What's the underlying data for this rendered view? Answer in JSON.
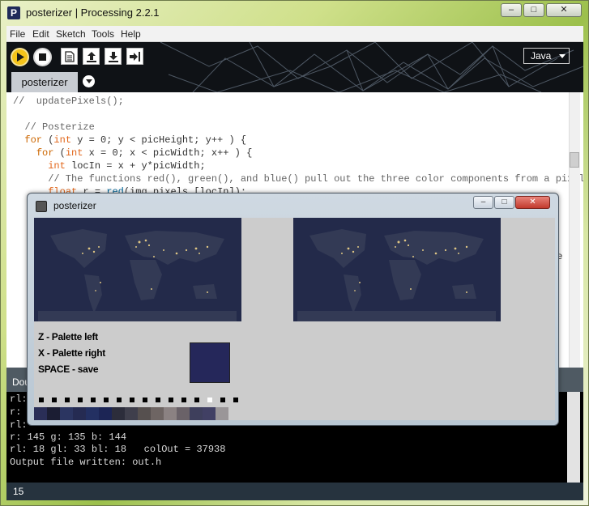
{
  "app": {
    "window_title": "posterizer | Processing 2.2.1",
    "logo_letter": "P",
    "window_buttons": {
      "minimize": "–",
      "maximize": "□",
      "close": "✕"
    }
  },
  "menu": [
    "File",
    "Edit",
    "Sketch",
    "Tools",
    "Help"
  ],
  "toolbar": {
    "mode": "Java",
    "icons": [
      "run-icon",
      "stop-icon",
      "new-icon",
      "open-icon",
      "save-icon",
      "export-icon"
    ]
  },
  "tabs": {
    "active": "posterizer"
  },
  "editor": {
    "lines": [
      [
        {
          "t": "//  updatePixels();",
          "c": "comment"
        }
      ],
      [],
      [
        {
          "t": "  // Posterize",
          "c": "comment"
        }
      ],
      [
        {
          "t": "  "
        },
        {
          "t": "for",
          "c": "keyword"
        },
        {
          "t": " ("
        },
        {
          "t": "int",
          "c": "type"
        },
        {
          "t": " y = 0; y < picHeight; y++ ) {"
        }
      ],
      [
        {
          "t": "    "
        },
        {
          "t": "for",
          "c": "keyword"
        },
        {
          "t": " ("
        },
        {
          "t": "int",
          "c": "type"
        },
        {
          "t": " x = 0; x < picWidth; x++ ) {"
        }
      ],
      [
        {
          "t": "      "
        },
        {
          "t": "int",
          "c": "type"
        },
        {
          "t": " locIn = x + y*picWidth;"
        }
      ],
      [
        {
          "t": "      // The functions red(), green(), and blue() pull out the three color components from a pixel",
          "c": "comment"
        }
      ],
      [
        {
          "t": "      "
        },
        {
          "t": "float",
          "c": "type"
        },
        {
          "t": " r = "
        },
        {
          "t": "red",
          "c": "func"
        },
        {
          "t": "(img.pixels [locIn]);"
        }
      ]
    ],
    "partial_text_right": "ne"
  },
  "status": {
    "text": "Dou"
  },
  "console": {
    "lines": [
      "rl:",
      "r:",
      "rl:",
      "r: 145 g: 135 b: 144",
      "rl: 18 gl: 33 bl: 18   colOut = 37938",
      "Output file written: out.h"
    ]
  },
  "line_number": "15",
  "sketch": {
    "window_title": "posterizer",
    "window_buttons": {
      "minimize": "–",
      "maximize": "□",
      "close": "✕"
    },
    "help_lines": [
      "Z - Palette left",
      "X - Palette right",
      "SPACE - save"
    ],
    "current_color": "#25275a",
    "palette_colors": [
      "#2a2e57",
      "#1b1d33",
      "#2b3561",
      "#252b52",
      "#233062",
      "#1c2555",
      "#2c2d3b",
      "#3f3f4c",
      "#56504f",
      "#6e6563",
      "#8b8282",
      "#6a6268",
      "#3e3f5c",
      "#414064",
      "#9a9698"
    ],
    "palette_markers": [
      "#000000",
      "#000000",
      "#000000",
      "#000000",
      "#000000",
      "#000000",
      "#000000",
      "#000000",
      "#000000",
      "#000000",
      "#000000",
      "#000000",
      "#000000",
      "#ffffff",
      "#000000",
      "#000000"
    ]
  },
  "colors": {
    "toolbar_bg": "#0f1216",
    "run_button": "#f6c41a",
    "status_bar": "#4f5a63",
    "console_bg": "#000000",
    "canvas_bg": "#cccccc",
    "ocean": "#232a4a",
    "land": "#333a55",
    "city_lights": "#f1d58a"
  }
}
